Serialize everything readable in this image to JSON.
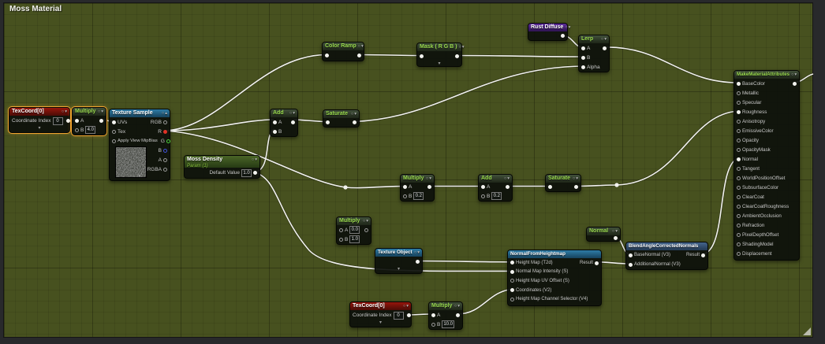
{
  "window": {
    "title": "Moss Material"
  },
  "colors": {
    "grid_bg": "#47511f",
    "titlebar": "#5e7e12",
    "wire": "#f2f2ee",
    "selection": "#f0a42f",
    "pin_red": "#e03226",
    "pin_green": "#4ad13c",
    "pin_blue": "#4253e0"
  },
  "icons": {
    "preview": "○",
    "collapse_down": "▾",
    "collapse_up": "▴",
    "expander": "⌄"
  },
  "nodes": {
    "texcoord_top": {
      "title": "TexCoord[0]",
      "field_label": "Coordinate Index",
      "field_value": "0"
    },
    "multiply_top": {
      "title": "Multiply",
      "a_label": "A",
      "b_label": "B",
      "b_value": "4.0"
    },
    "texture_sample": {
      "title": "Texture Sample",
      "inputs": [
        "UVs",
        "Tex",
        "Apply View MipBias"
      ],
      "outputs": [
        "RGB",
        "R",
        "G",
        "B",
        "A",
        "RGBA"
      ]
    },
    "color_ramp": {
      "title": "Color Ramp"
    },
    "mask_rgb": {
      "title": "Mask ( R G B )"
    },
    "rust_diffuse": {
      "title": "Rust Diffuse"
    },
    "lerp": {
      "title": "Lerp",
      "inputs": [
        "A",
        "B",
        "Alpha"
      ]
    },
    "add_top": {
      "title": "Add",
      "a_label": "A",
      "b_label": "B"
    },
    "saturate_top": {
      "title": "Saturate"
    },
    "moss_density": {
      "title": "Moss Density",
      "subtitle": "Param (1)",
      "field_label": "Default Value",
      "field_value": "1.0"
    },
    "multiply_mid": {
      "title": "Multiply",
      "a_label": "A",
      "b_label": "B",
      "b_value": "0.2"
    },
    "add_mid": {
      "title": "Add",
      "a_label": "A",
      "b_label": "B",
      "b_value": "0.2"
    },
    "saturate_mid": {
      "title": "Saturate"
    },
    "multiply_float": {
      "title": "Multiply",
      "a_label": "A",
      "a_value": "0.0",
      "b_label": "B",
      "b_value": "1.0"
    },
    "texture_object": {
      "title": "Texture Object"
    },
    "normal_from_heightmap": {
      "title": "NormalFromHeightmap",
      "output": "Result",
      "inputs": [
        {
          "label": "Height Map (T2d)",
          "connected": true
        },
        {
          "label": "Normal Map Intensity (S)",
          "connected": true
        },
        {
          "label": "Height Map UV Offset (S)",
          "connected": false
        },
        {
          "label": "Coordinates (V2)",
          "connected": true
        },
        {
          "label": "Height Map Channel Selector (V4)",
          "connected": false
        }
      ]
    },
    "normal": {
      "title": "Normal"
    },
    "blend_angle": {
      "title": "BlendAngleCorrectedNormals",
      "base_label": "BaseNormal (V3)",
      "add_label": "AdditionalNormal (V3)",
      "output": "Result"
    },
    "make_material_attributes": {
      "title": "MakeMaterialAttributes",
      "pins": [
        {
          "label": "BaseColor",
          "connected": true
        },
        {
          "label": "Metallic",
          "connected": false
        },
        {
          "label": "Specular",
          "connected": false
        },
        {
          "label": "Roughness",
          "connected": true
        },
        {
          "label": "Anisotropy",
          "connected": false
        },
        {
          "label": "EmissiveColor",
          "connected": false
        },
        {
          "label": "Opacity",
          "connected": false
        },
        {
          "label": "OpacityMask",
          "connected": false
        },
        {
          "label": "Normal",
          "connected": true
        },
        {
          "label": "Tangent",
          "connected": false
        },
        {
          "label": "WorldPositionOffset",
          "connected": false
        },
        {
          "label": "SubsurfaceColor",
          "connected": false
        },
        {
          "label": "ClearCoat",
          "connected": false
        },
        {
          "label": "ClearCoatRoughness",
          "connected": false
        },
        {
          "label": "AmbientOcclusion",
          "connected": false
        },
        {
          "label": "Refraction",
          "connected": false
        },
        {
          "label": "PixelDepthOffset",
          "connected": false
        },
        {
          "label": "ShadingModel",
          "connected": false
        },
        {
          "label": "Displacement",
          "connected": false
        }
      ]
    },
    "texcoord_bottom": {
      "title": "TexCoord[0]",
      "field_label": "Coordinate Index",
      "field_value": "0"
    },
    "multiply_bottom": {
      "title": "Multiply",
      "a_label": "A",
      "b_label": "B",
      "b_value": "10.0"
    }
  }
}
